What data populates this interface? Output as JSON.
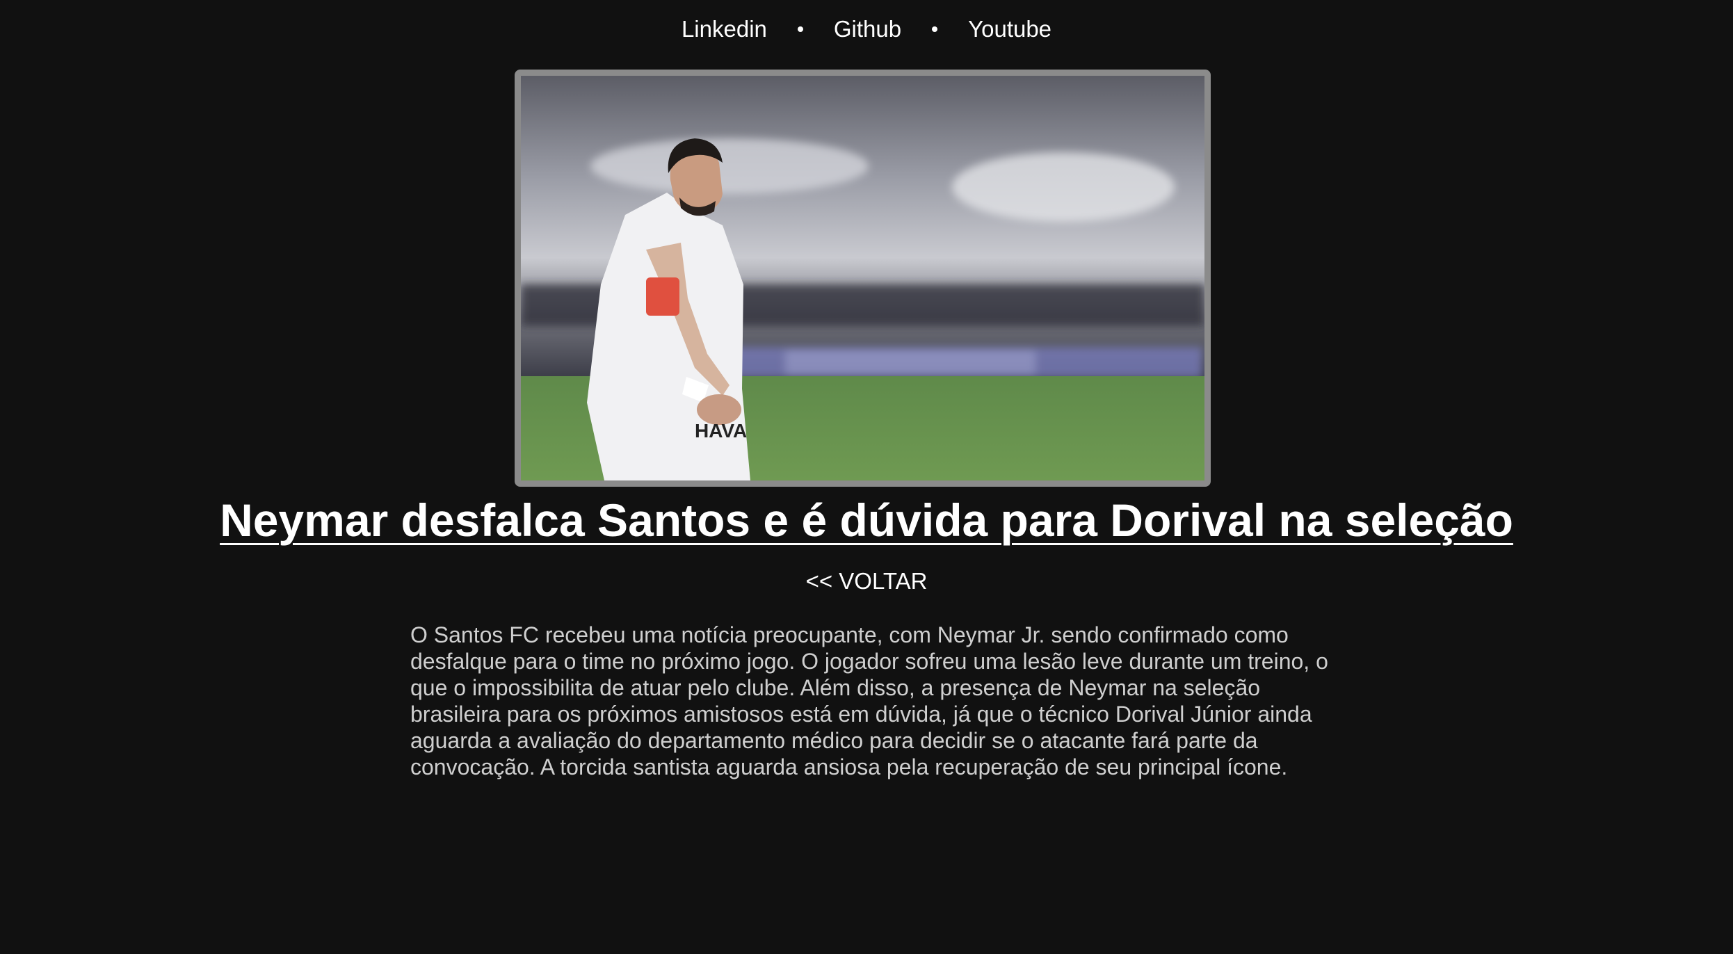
{
  "nav": {
    "links": [
      {
        "label": "Linkedin"
      },
      {
        "label": "Github"
      },
      {
        "label": "Youtube"
      }
    ]
  },
  "article": {
    "image_alt": "Neymar com a camisa do Santos",
    "title": "Neymar desfalca Santos e é dúvida para Dorival na seleção",
    "back_label": "<< VOLTAR",
    "body": "O Santos FC recebeu uma notícia preocupante, com Neymar Jr. sendo confirmado como desfalque para o time no próximo jogo. O jogador sofreu uma lesão leve durante um treino, o que o impossibilita de atuar pelo clube. Além disso, a presença de Neymar na seleção brasileira para os próximos amistosos está em dúvida, já que o técnico Dorival Júnior ainda aguarda a avaliação do departamento médico para decidir se o atacante fará parte da convocação. A torcida santista aguarda ansiosa pela recuperação de seu principal ícone."
  },
  "colors": {
    "background": "#111111",
    "text": "#ffffff",
    "body_text": "#cfcfcf",
    "image_border": "#8b8b8b"
  }
}
